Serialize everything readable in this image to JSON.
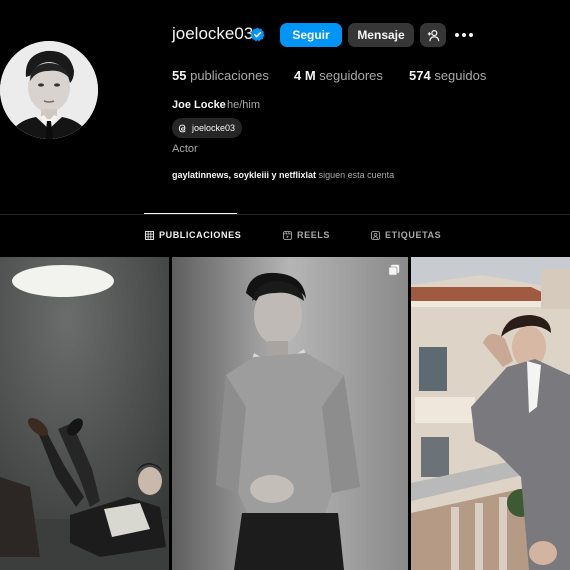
{
  "profile": {
    "username": "joelocke03",
    "full_name": "Joe Locke",
    "pronouns": "he/him",
    "threads_handle": "joelocke03",
    "category": "Actor"
  },
  "actions": {
    "follow": "Seguir",
    "message": "Mensaje"
  },
  "stats": {
    "posts_count": "55",
    "posts_label": "publicaciones",
    "followers_count": "4 M",
    "followers_label": "seguidores",
    "following_count": "574",
    "following_label": "seguidos"
  },
  "followed_by": {
    "names_text": "gaylatinnews, soykleiii y netflixlat",
    "suffix": "siguen esta cuenta"
  },
  "tabs": [
    {
      "label": "PUBLICACIONES",
      "active": true
    },
    {
      "label": "REELS",
      "active": false
    },
    {
      "label": "ETIQUETAS",
      "active": false
    }
  ],
  "colors": {
    "follow_button": "#0095f6",
    "secondary_button": "#363636",
    "verified": "#0095f6"
  }
}
